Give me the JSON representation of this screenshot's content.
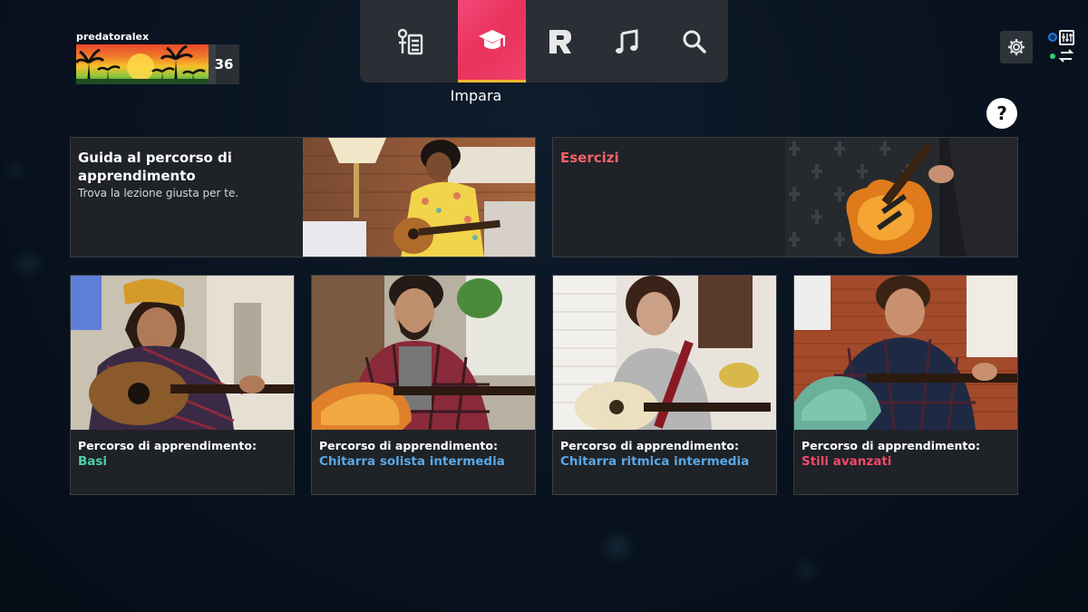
{
  "profile": {
    "username": "predatoralex",
    "level": "36"
  },
  "nav": {
    "items": [
      {
        "id": "songs",
        "icon": "song-library-icon"
      },
      {
        "id": "learn",
        "icon": "graduation-cap-icon",
        "label": "Impara",
        "active": true
      },
      {
        "id": "rocksmith",
        "icon": "r-logo-icon"
      },
      {
        "id": "music",
        "icon": "music-note-icon"
      },
      {
        "id": "search",
        "icon": "search-icon"
      }
    ],
    "active_label": "Impara"
  },
  "help": {
    "label": "?"
  },
  "cards": {
    "guide": {
      "title": "Guida al percorso di apprendimento",
      "subtitle": "Trova la lezione giusta per te."
    },
    "exercises": {
      "title": "Esercizi"
    }
  },
  "lessons": [
    {
      "caption": "Percorso di apprendimento:",
      "path": "Basi",
      "color": "#4fd1a8"
    },
    {
      "caption": "Percorso di apprendimento:",
      "path": "Chitarra solista intermedia",
      "color": "#5aa8e6"
    },
    {
      "caption": "Percorso di apprendimento:",
      "path": "Chitarra ritmica intermedia",
      "color": "#5aa8e6"
    },
    {
      "caption": "Percorso di apprendimento:",
      "path": "Stili avanzati",
      "color": "#f24a68"
    }
  ],
  "colors": {
    "accent": "#f0406d",
    "active_underline": "#f2b630",
    "exercises_title": "#f2636a"
  }
}
